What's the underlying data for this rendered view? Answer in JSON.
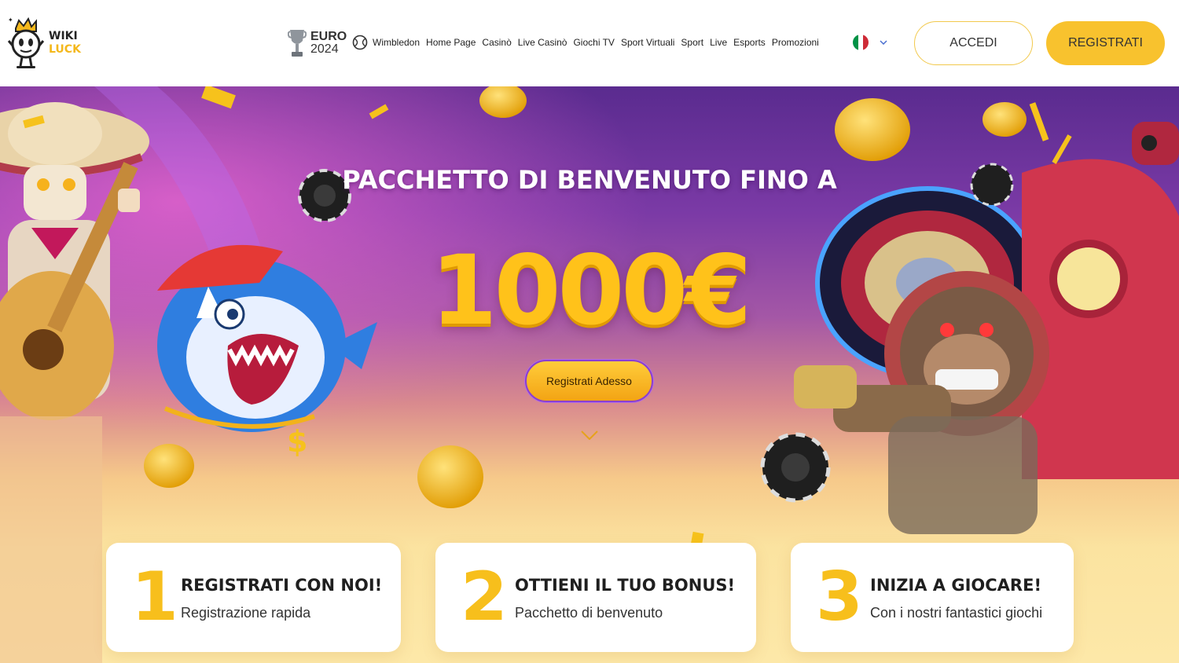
{
  "header": {
    "logo": {
      "line1": "WIKI",
      "line2": "LUCK"
    },
    "euro": {
      "line1": "EURO",
      "line2": "2024"
    },
    "nav": [
      {
        "label": "Wimbledon"
      },
      {
        "label": "Home Page"
      },
      {
        "label": "Casinò"
      },
      {
        "label": "Live Casinò"
      },
      {
        "label": "Giochi TV"
      },
      {
        "label": "Sport Virtuali"
      },
      {
        "label": "Sport"
      },
      {
        "label": "Live"
      },
      {
        "label": "Esports"
      },
      {
        "label": "Promozioni"
      }
    ],
    "language": {
      "flag": "italy-flag-icon",
      "colors": [
        "#009246",
        "#ffffff",
        "#ce2b37"
      ]
    },
    "login_label": "ACCEDI",
    "register_label": "REGISTRATI"
  },
  "hero": {
    "title": "PACCHETTO DI BENVENUTO FINO A",
    "amount": "1000€",
    "cta_label": "Registrati Adesso"
  },
  "steps": [
    {
      "number": "1",
      "title": "REGISTRATI CON NOI!",
      "subtitle": "Registrazione rapida"
    },
    {
      "number": "2",
      "title": "OTTIENI IL TUO BONUS!",
      "subtitle": "Pacchetto di benvenuto"
    },
    {
      "number": "3",
      "title": "INIZIA A GIOCARE!",
      "subtitle": "Con i nostri fantastici giochi"
    }
  ],
  "colors": {
    "accent": "#f8c22e",
    "amount": "#ffc21a",
    "hero_top": "#5a2b8f",
    "hero_bottom": "#fde8a8"
  }
}
